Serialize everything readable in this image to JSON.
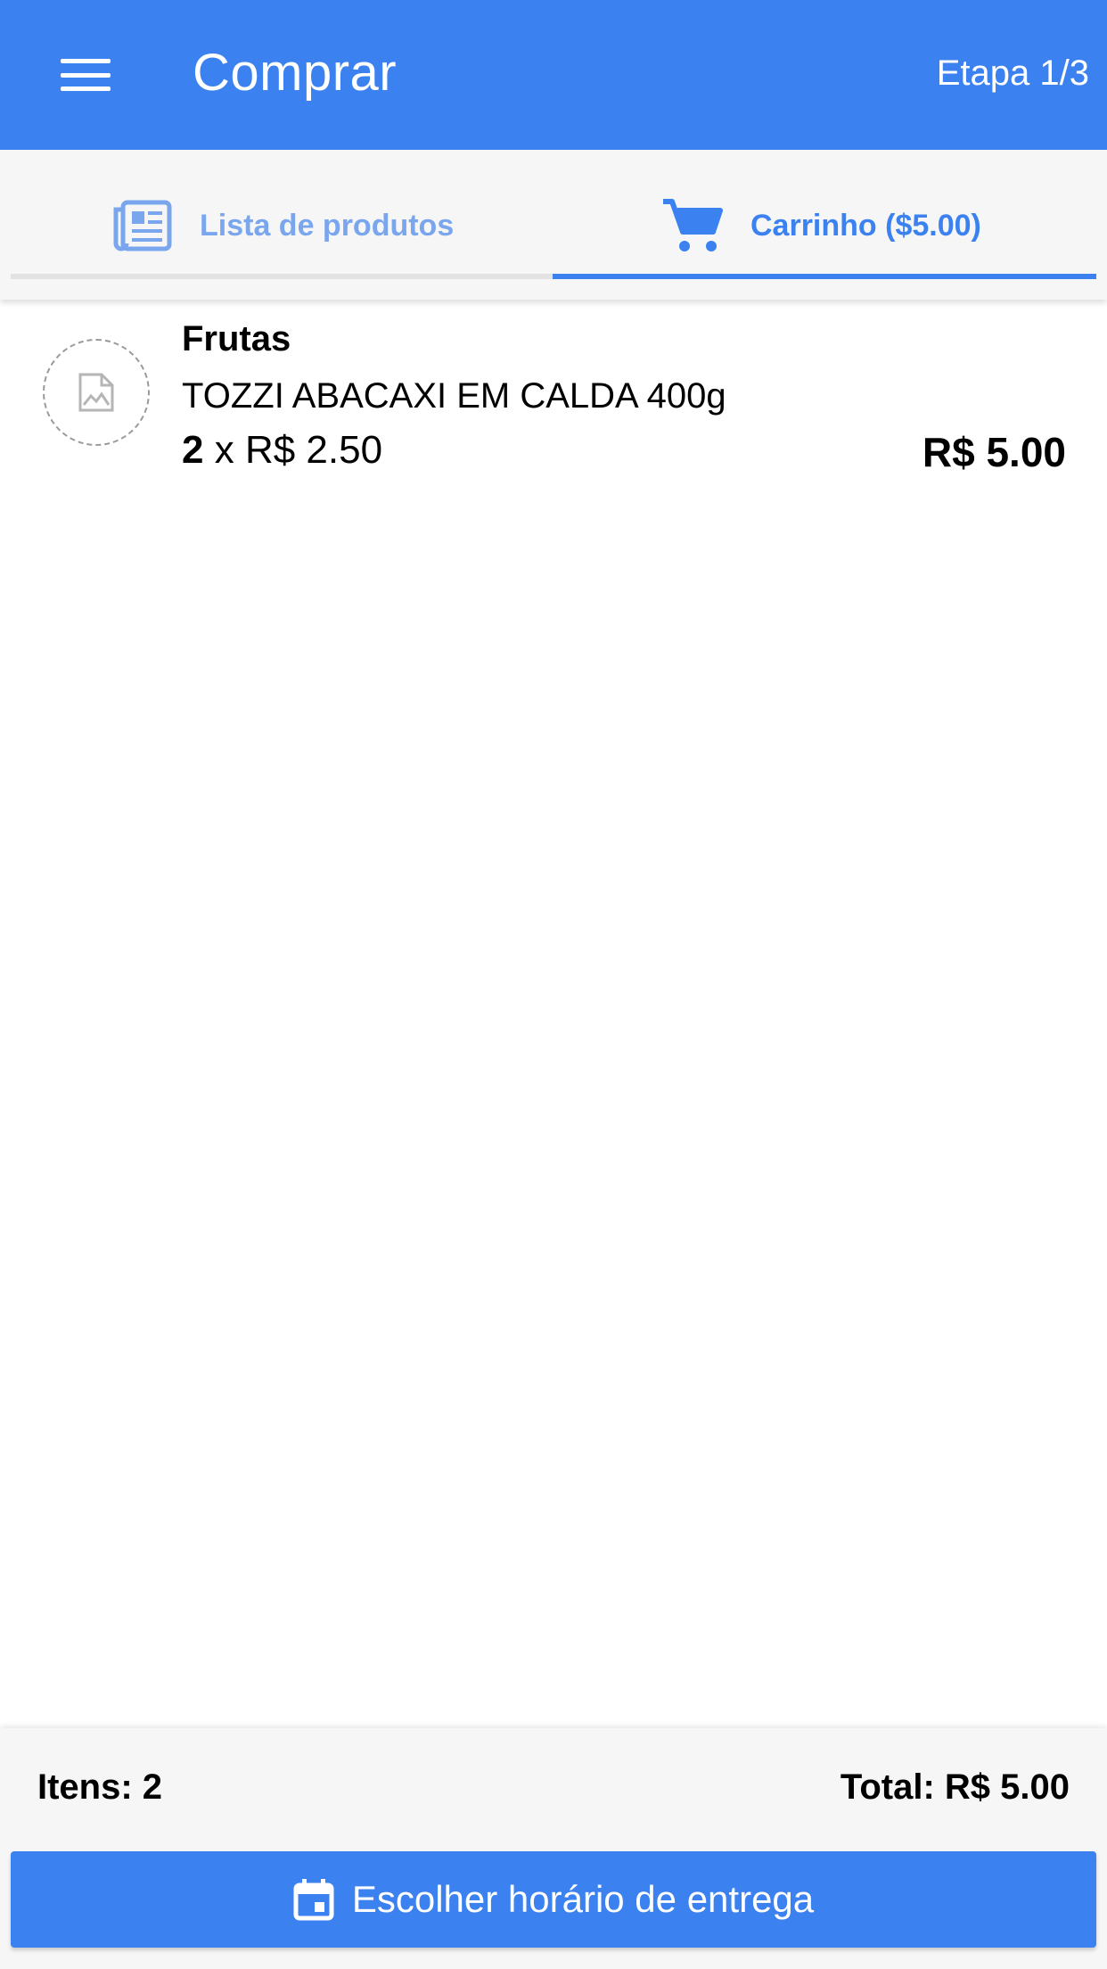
{
  "header": {
    "title": "Comprar",
    "step": "Etapa 1/3",
    "menu_icon": "hamburger-menu-icon"
  },
  "tabs": [
    {
      "label": "Lista de produtos",
      "icon": "newspaper-list-icon",
      "active": false
    },
    {
      "label": "Carrinho ($5.00)",
      "icon": "shopping-cart-icon",
      "active": true
    }
  ],
  "cart": {
    "items": [
      {
        "category": "Frutas",
        "name": "TOZZI ABACAXI EM CALDA 400g",
        "quantity": "2",
        "unit_price": "x R$ 2.50",
        "line_total": "R$ 5.00",
        "image_icon": "broken-image-icon"
      }
    ]
  },
  "footer": {
    "items_label": "Itens: 2",
    "total_label": "Total: R$ 5.00",
    "cta_label": "Escolher horário de entrega",
    "cta_icon": "calendar-icon"
  },
  "colors": {
    "primary": "#3b82f0",
    "inactive_tab": "#7aa6ee",
    "surface": "#f6f6f6"
  }
}
